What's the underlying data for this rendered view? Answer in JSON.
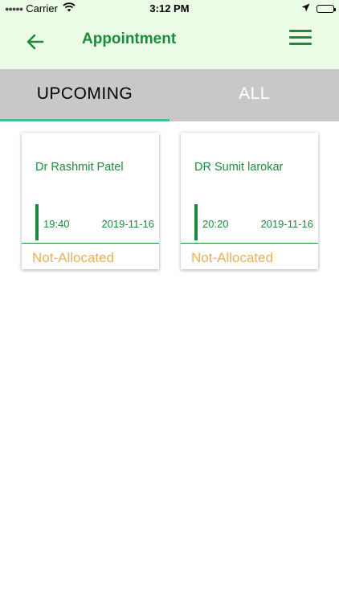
{
  "status_bar": {
    "carrier": "Carrier",
    "time": "3:12 PM",
    "icons": [
      "signal-dots-icon",
      "wifi-icon",
      "location-arrow-icon",
      "battery-icon"
    ]
  },
  "header": {
    "title": "Appointment",
    "back_icon": "arrow-left-icon",
    "menu_icon": "hamburger-menu-icon",
    "accent_color": "#1e8a3e",
    "background_color": "#eafbe6"
  },
  "tabs": [
    {
      "label": "UPCOMING",
      "selected": true
    },
    {
      "label": "ALL",
      "selected": false
    }
  ],
  "appointments": [
    {
      "doctor": "Dr Rashmit Patel",
      "time": "19:40",
      "date": "2019-11-16",
      "status": "Not-Allocated"
    },
    {
      "doctor": "DR Sumit larokar",
      "time": "20:20",
      "date": "2019-11-16",
      "status": "Not-Allocated"
    }
  ],
  "colors": {
    "tab_background": "#c8c8c8",
    "tab_indicator": "#3fbf8f",
    "status_text": "#e8b057"
  }
}
